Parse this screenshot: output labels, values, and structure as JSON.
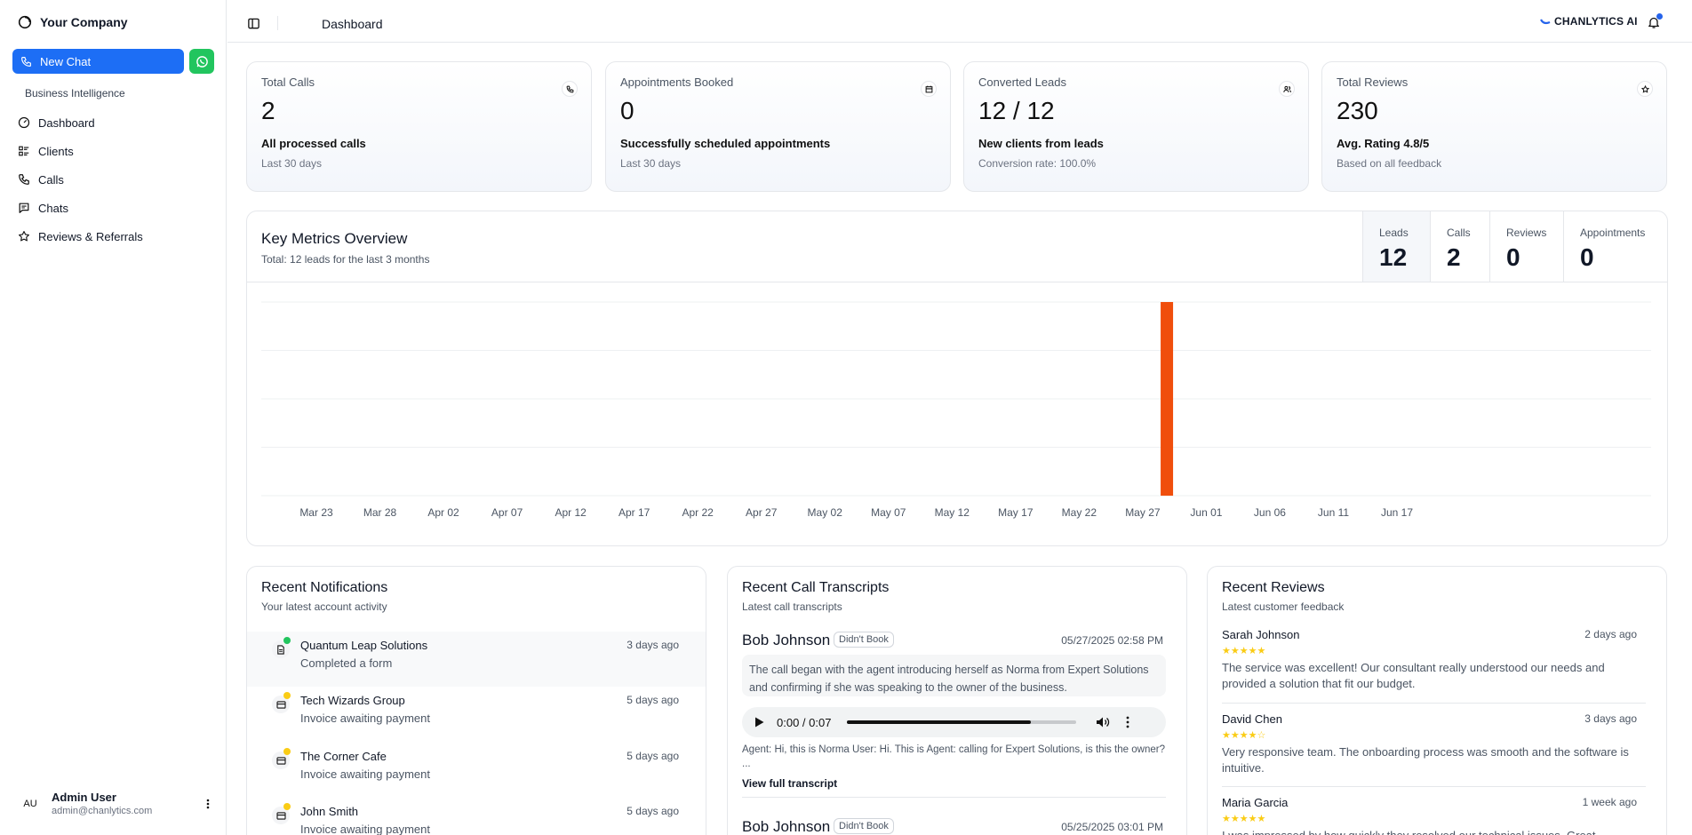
{
  "sidebar": {
    "company": "Your Company",
    "new_chat": "New Chat",
    "section": "Business Intelligence",
    "items": [
      {
        "label": "Dashboard",
        "icon": "gauge-icon"
      },
      {
        "label": "Clients",
        "icon": "list-icon"
      },
      {
        "label": "Calls",
        "icon": "phone-icon"
      },
      {
        "label": "Chats",
        "icon": "message-icon"
      },
      {
        "label": "Reviews & Referrals",
        "icon": "star-icon"
      }
    ],
    "user": {
      "initials": "AU",
      "name": "Admin User",
      "email": "admin@chanlytics.com"
    }
  },
  "header": {
    "title": "Dashboard",
    "brand": "CHANLYTICS AI"
  },
  "stats": [
    {
      "label": "Total Calls",
      "value": "2",
      "sub": "All processed calls",
      "muted": "Last 30 days",
      "icon": "phone-icon"
    },
    {
      "label": "Appointments Booked",
      "value": "0",
      "sub": "Successfully scheduled appointments",
      "muted": "Last 30 days",
      "icon": "calendar-icon"
    },
    {
      "label": "Converted Leads",
      "value": "12 / 12",
      "sub": "New clients from leads",
      "muted": "Conversion rate: 100.0%",
      "icon": "users-icon"
    },
    {
      "label": "Total Reviews",
      "value": "230",
      "sub": "Avg. Rating 4.8/5",
      "muted": "Based on all feedback",
      "icon": "star-icon"
    }
  ],
  "metrics": {
    "title": "Key Metrics Overview",
    "subtitle": "Total: 12 leads for the last 3 months",
    "tabs": [
      {
        "label": "Leads",
        "value": "12"
      },
      {
        "label": "Calls",
        "value": "2"
      },
      {
        "label": "Reviews",
        "value": "0"
      },
      {
        "label": "Appointments",
        "value": "0"
      }
    ]
  },
  "chart_data": {
    "type": "bar",
    "categories": [
      "Mar 23",
      "Mar 28",
      "Apr 02",
      "Apr 07",
      "Apr 12",
      "Apr 17",
      "Apr 22",
      "Apr 27",
      "May 02",
      "May 07",
      "May 12",
      "May 17",
      "May 22",
      "May 27",
      "Jun 01",
      "Jun 06",
      "Jun 11",
      "Jun 17"
    ],
    "series": [
      {
        "values": [
          0,
          0,
          0,
          0,
          0,
          0,
          0,
          0,
          0,
          0,
          0,
          0,
          0,
          12,
          0,
          0,
          0,
          0
        ]
      }
    ],
    "bar_position": 13.38,
    "ylim": [
      0,
      12
    ],
    "grid": true,
    "bar_color": "#f04e0c"
  },
  "notifications": {
    "title": "Recent Notifications",
    "subtitle": "Your latest account activity",
    "items": [
      {
        "name": "Quantum Leap Solutions",
        "desc": "Completed a form",
        "time": "3 days ago",
        "dot": "#22c55e",
        "icon": "document-icon"
      },
      {
        "name": "Tech Wizards Group",
        "desc": "Invoice awaiting payment",
        "time": "5 days ago",
        "dot": "#facc15",
        "icon": "card-icon"
      },
      {
        "name": "The Corner Cafe",
        "desc": "Invoice awaiting payment",
        "time": "5 days ago",
        "dot": "#facc15",
        "icon": "card-icon"
      },
      {
        "name": "John Smith",
        "desc": "Invoice awaiting payment",
        "time": "5 days ago",
        "dot": "#facc15",
        "icon": "card-icon"
      }
    ]
  },
  "transcripts": {
    "title": "Recent Call Transcripts",
    "subtitle": "Latest call transcripts",
    "items": [
      {
        "name": "Bob Johnson",
        "badge": "Didn't Book",
        "date": "05/27/2025 02:58 PM",
        "summary": "The call began with the agent introducing herself as Norma from Expert Solutions and confirming if she was speaking to the owner of the business.",
        "time": "0:00 / 0:07",
        "progress": 0.8,
        "snippet": "Agent: Hi, this is Norma User: Hi. This is Agent: calling for Expert Solutions, is this the owner? ...",
        "link": "View full transcript"
      },
      {
        "name": "Bob Johnson",
        "badge": "Didn't Book",
        "date": "05/25/2025 03:01 PM"
      }
    ]
  },
  "reviews": {
    "title": "Recent Reviews",
    "subtitle": "Latest customer feedback",
    "items": [
      {
        "name": "Sarah Johnson",
        "time": "2 days ago",
        "stars": "★★★★★",
        "text": "The service was excellent! Our consultant really understood our needs and provided a solution that fit our budget."
      },
      {
        "name": "David Chen",
        "time": "3 days ago",
        "stars": "★★★★☆",
        "text": "Very responsive team. The onboarding process was smooth and the software is intuitive."
      },
      {
        "name": "Maria Garcia",
        "time": "1 week ago",
        "stars": "★★★★★",
        "text": "I was impressed by how quickly they resolved our technical issues. Great customer"
      }
    ]
  }
}
